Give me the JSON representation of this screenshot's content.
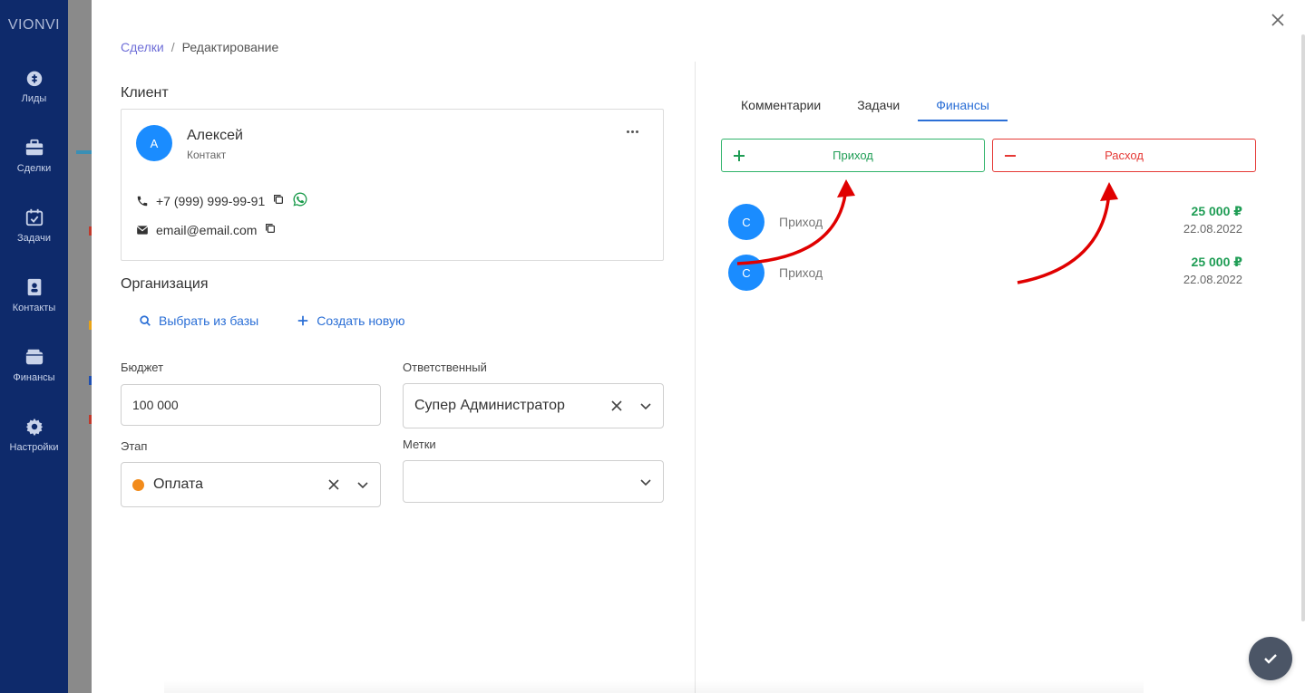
{
  "app": {
    "brand": "VIONVI"
  },
  "sidebar": {
    "items": [
      {
        "label": "Лиды",
        "icon": "dollar-bag-icon"
      },
      {
        "label": "Сделки",
        "icon": "briefcase-icon"
      },
      {
        "label": "Задачи",
        "icon": "calendar-check-icon"
      },
      {
        "label": "Контакты",
        "icon": "address-book-icon"
      },
      {
        "label": "Финансы",
        "icon": "wallet-icon"
      },
      {
        "label": "Настройки",
        "icon": "gear-icon"
      }
    ]
  },
  "breadcrumb": {
    "parent": "Сделки",
    "separator": "/",
    "current": "Редактирование"
  },
  "client": {
    "section_title": "Клиент",
    "avatar_letter": "А",
    "name": "Алексей",
    "role": "Контакт",
    "phone": "+7 (999) 999-99-91",
    "email": "email@email.com"
  },
  "organization": {
    "section_title": "Организация",
    "select_from_db": "Выбрать из базы",
    "create_new": "Создать новую"
  },
  "form": {
    "budget_label": "Бюджет",
    "budget_value": "100 000",
    "responsible_label": "Ответственный",
    "responsible_value": "Супер Администратор",
    "stage_label": "Этап",
    "stage_value": "Оплата",
    "stage_color": "#f28b1b",
    "tags_label": "Метки",
    "tags_value": ""
  },
  "tabs": [
    {
      "label": "Комментарии",
      "active": false
    },
    {
      "label": "Задачи",
      "active": false
    },
    {
      "label": "Финансы",
      "active": true
    }
  ],
  "finance": {
    "income_button": "Приход",
    "expense_button": "Расход",
    "records": [
      {
        "avatar_letter": "С",
        "label": "Приход",
        "amount": "25 000 ₽",
        "date": "22.08.2022"
      },
      {
        "avatar_letter": "С",
        "label": "Приход",
        "amount": "25 000 ₽",
        "date": "22.08.2022"
      }
    ]
  },
  "colors": {
    "sidebar_bg": "#0e2a6b",
    "accent": "#2b6fd6",
    "income": "#1f9d55",
    "expense": "#e53935",
    "avatar": "#1a8cff"
  }
}
